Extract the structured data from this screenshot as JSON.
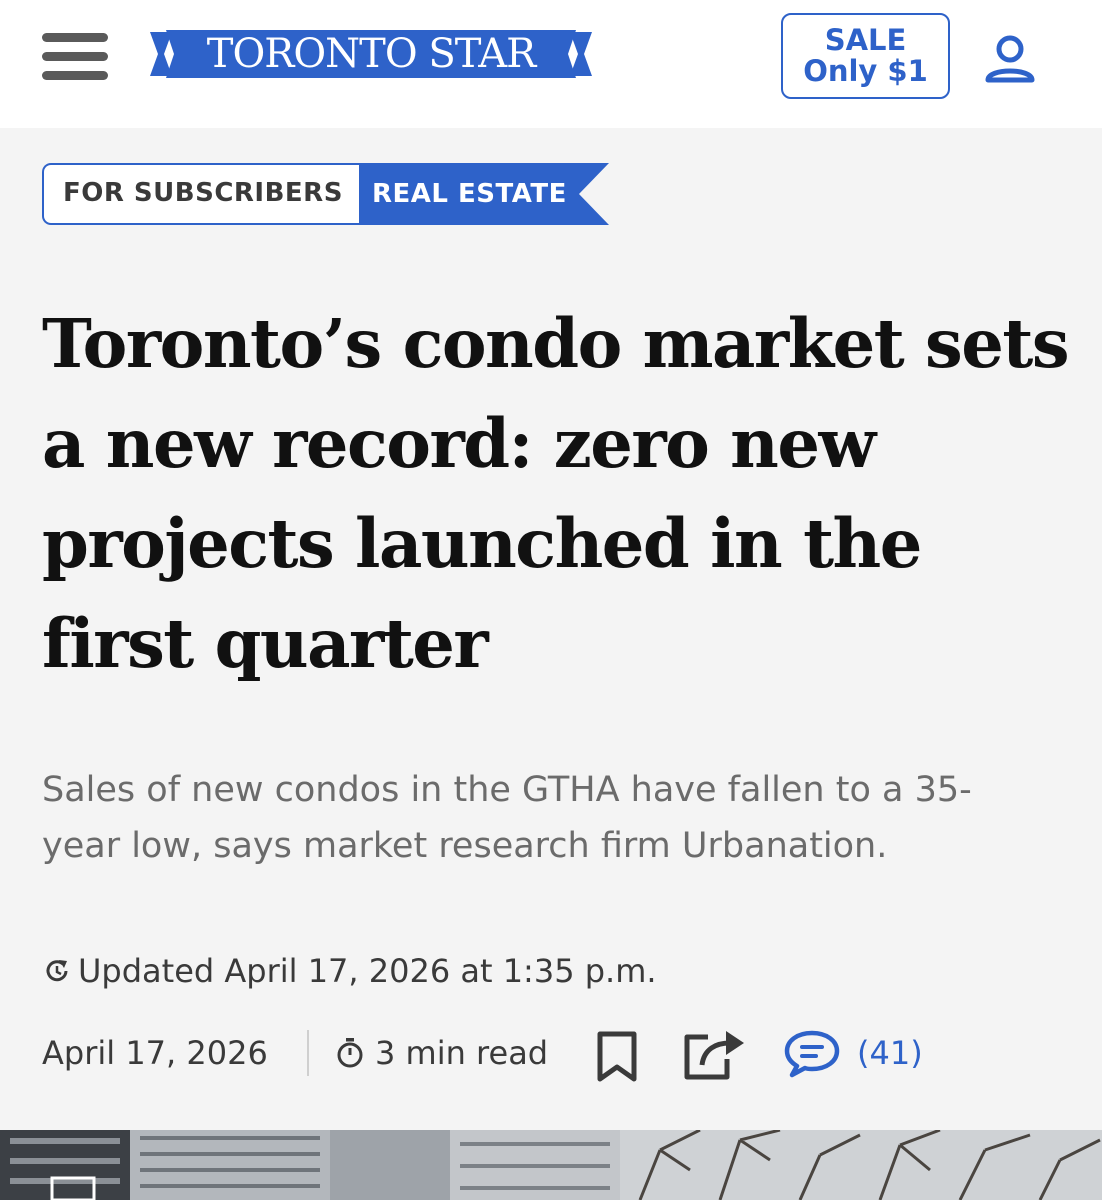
{
  "header": {
    "menu_icon": "hamburger-menu-icon",
    "logo_text": "TORONTO STAR",
    "brand_color": "#2e62c9",
    "sale_line1": "SALE",
    "sale_line2": "Only $1",
    "account_icon": "user-account-icon"
  },
  "tags": {
    "subscribers": "FOR SUBSCRIBERS",
    "section": "REAL ESTATE"
  },
  "article": {
    "headline": "Toronto’s condo market sets a new record: zero new projects launched in the first quarter",
    "dek": "Sales of new condos in the GTHA have fallen to a 35-year low, says market research firm Urbanation.",
    "updated": "Updated April 17, 2026 at 1:35 p.m.",
    "date": "April 17, 2026",
    "read_time": "3 min read",
    "comment_count": "(41)",
    "icons": [
      "refresh-icon",
      "timer-icon",
      "bookmark-icon",
      "share-icon",
      "comment-icon"
    ]
  },
  "colors": {
    "background": "#f4f4f4",
    "text": "#111111",
    "muted": "#6b6b6b"
  }
}
